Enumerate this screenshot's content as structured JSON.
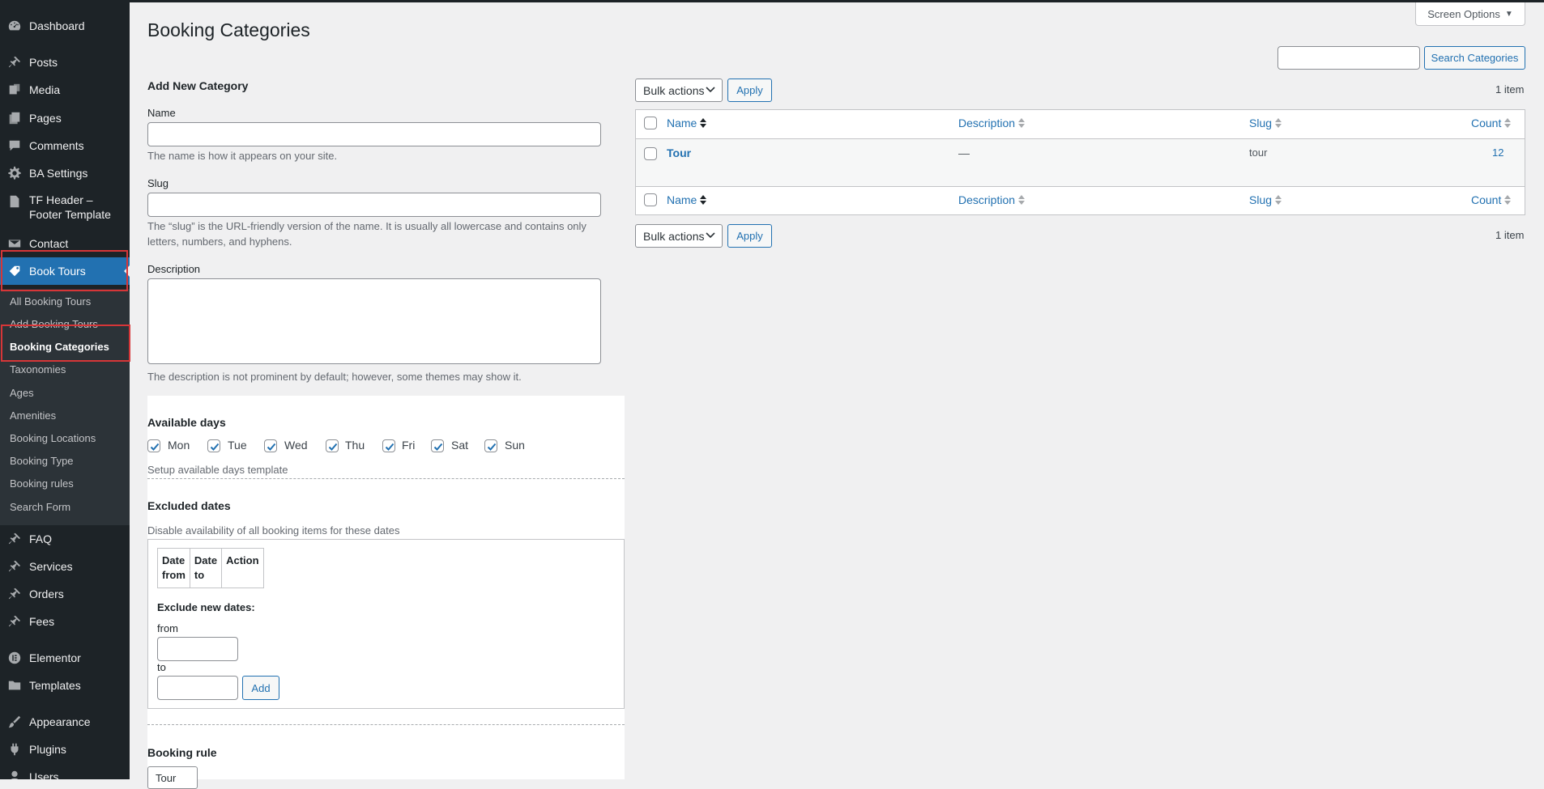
{
  "sidebar": {
    "menu": [
      {
        "label": "Dashboard",
        "icon": "dashboard-icon"
      },
      {
        "label": "Posts",
        "icon": "pin-icon"
      },
      {
        "label": "Media",
        "icon": "media-icon"
      },
      {
        "label": "Pages",
        "icon": "pages-icon"
      },
      {
        "label": "Comments",
        "icon": "comment-icon"
      },
      {
        "label": "BA Settings",
        "icon": "gear-icon"
      },
      {
        "label": "TF Header – Footer Template",
        "icon": "document-icon"
      },
      {
        "label": "Contact",
        "icon": "mail-icon"
      },
      {
        "label": "Book Tours",
        "icon": "tag-icon"
      },
      {
        "label": "FAQ",
        "icon": "pin-icon"
      },
      {
        "label": "Services",
        "icon": "pin-icon"
      },
      {
        "label": "Orders",
        "icon": "pin-icon"
      },
      {
        "label": "Fees",
        "icon": "pin-icon"
      },
      {
        "label": "Elementor",
        "icon": "elementor-icon"
      },
      {
        "label": "Templates",
        "icon": "folder-icon"
      },
      {
        "label": "Appearance",
        "icon": "brush-icon"
      },
      {
        "label": "Plugins",
        "icon": "plug-icon"
      },
      {
        "label": "Users",
        "icon": "user-icon"
      }
    ],
    "submenu": [
      "All Booking Tours",
      "Add Booking Tours",
      "Booking Categories",
      "Taxonomies",
      "Ages",
      "Amenities",
      "Booking Locations",
      "Booking Type",
      "Booking rules",
      "Search Form"
    ]
  },
  "header": {
    "title": "Booking Categories",
    "screen_options": "Screen Options"
  },
  "search": {
    "value": "",
    "button": "Search Categories"
  },
  "form": {
    "heading": "Add New Category",
    "name_label": "Name",
    "name_value": "",
    "name_help": "The name is how it appears on your site.",
    "slug_label": "Slug",
    "slug_value": "",
    "slug_help_1": "The “slug” is the URL-friendly version of the name. It is usually all lowercase and contains only",
    "slug_help_2": "letters, numbers, and hyphens.",
    "description_label": "Description",
    "description_value": "",
    "description_help": "The description is not prominent by default; however, some themes may show it.",
    "available_days": {
      "heading": "Available days",
      "days": [
        {
          "label": "Mon",
          "checked": true
        },
        {
          "label": "Tue",
          "checked": true
        },
        {
          "label": "Wed",
          "checked": true
        },
        {
          "label": "Thu",
          "checked": true
        },
        {
          "label": "Fri",
          "checked": true
        },
        {
          "label": "Sat",
          "checked": true
        },
        {
          "label": "Sun",
          "checked": true
        }
      ],
      "help": "Setup available days template"
    },
    "excluded_dates": {
      "heading": "Excluded dates",
      "help": "Disable availability of all booking items for these dates",
      "col_from": "Date from",
      "col_from_1": "Date",
      "col_from_2": "from",
      "col_to_1": "Date",
      "col_to_2": "to",
      "col_action": "Action",
      "exclude_heading": "Exclude new dates:",
      "from_label": "from",
      "to_label": "to",
      "add_button": "Add"
    },
    "booking_rule": {
      "heading": "Booking rule",
      "selected": "Tour"
    }
  },
  "table": {
    "bulk_actions": "Bulk actions",
    "apply": "Apply",
    "items_count": "1 item",
    "columns": {
      "name": "Name",
      "description": "Description",
      "slug": "Slug",
      "count": "Count"
    },
    "rows": [
      {
        "name": "Tour",
        "description": "—",
        "slug": "tour",
        "count": "12"
      }
    ]
  },
  "colors": {
    "sidebar_bg": "#1d2327",
    "submenu_bg": "#2c3338",
    "accent": "#2271b1",
    "highlight": "#d63638",
    "page_bg": "#f0f0f1"
  }
}
